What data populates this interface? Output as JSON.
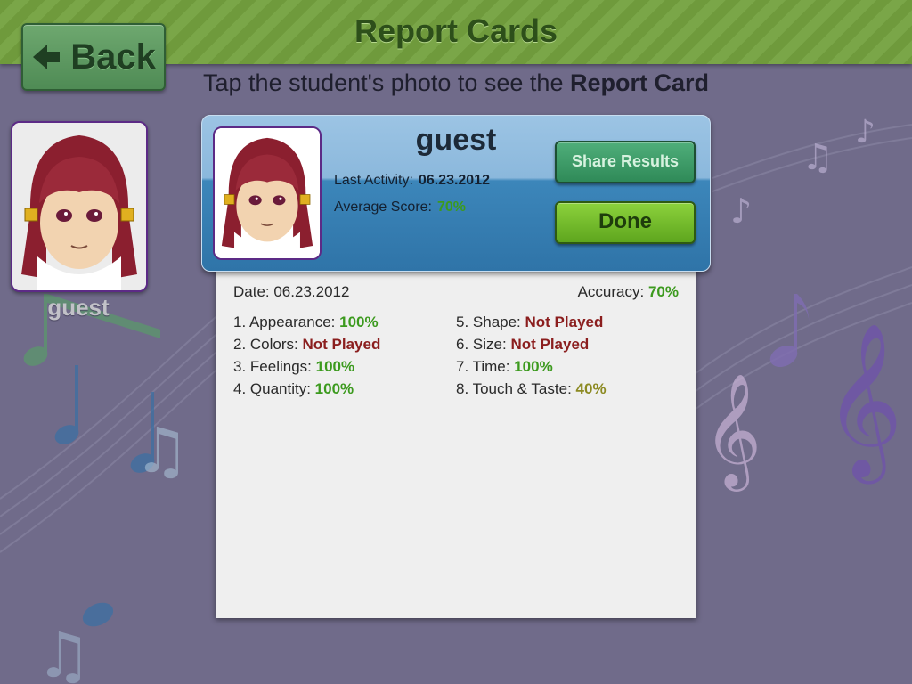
{
  "header": {
    "title": "Report Cards",
    "back_label": "Back"
  },
  "subtitle": {
    "prefix": "Tap the student's photo to see the ",
    "emphasis": "Report Card"
  },
  "student_tile": {
    "name": "guest"
  },
  "report_card": {
    "name": "guest",
    "last_activity_label": "Last Activity:",
    "last_activity_value": "06.23.2012",
    "average_score_label": "Average Score:",
    "average_score_value": "70%",
    "share_label": "Share Results",
    "done_label": "Done",
    "date_text": "Date: 06.23.2012",
    "accuracy_label": "Accuracy:",
    "accuracy_value": "70%",
    "items": [
      {
        "label": "1. Appearance:",
        "value": "100%",
        "color": "#3c9a1e"
      },
      {
        "label": "2. Colors:",
        "value": "Not Played",
        "color": "#8b1e1e"
      },
      {
        "label": "3. Feelings:",
        "value": "100%",
        "color": "#3c9a1e"
      },
      {
        "label": "4. Quantity:",
        "value": "100%",
        "color": "#3c9a1e"
      },
      {
        "label": "5. Shape:",
        "value": "Not Played",
        "color": "#8b1e1e"
      },
      {
        "label": "6. Size:",
        "value": "Not Played",
        "color": "#8b1e1e"
      },
      {
        "label": "7. Time:",
        "value": "100%",
        "color": "#3c9a1e"
      },
      {
        "label": "8. Touch & Taste:",
        "value": "40%",
        "color": "#8c8a22"
      }
    ]
  },
  "colors": {
    "header_green": "#6f9a3c",
    "background": "#706b8a",
    "score_green": "#3c9a1e",
    "not_played_red": "#8b1e1e",
    "low_score_olive": "#8c8a22"
  }
}
